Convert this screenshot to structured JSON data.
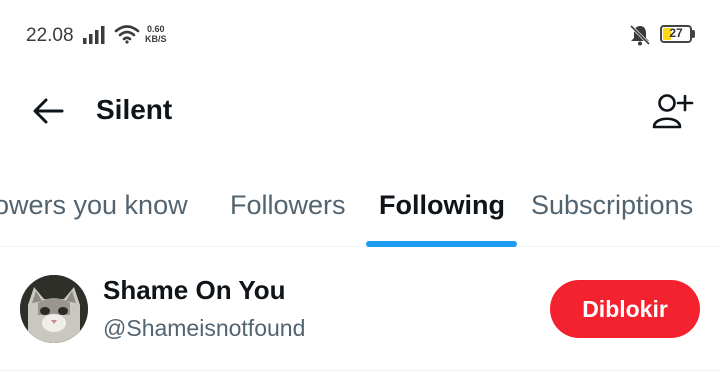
{
  "status_bar": {
    "time": "22.08",
    "speed_value": "0.60",
    "speed_unit": "KB/S",
    "battery": "27",
    "icons": [
      "signal-icon",
      "wifi-icon",
      "bell-muted-icon",
      "battery-icon"
    ],
    "battery_color": "#ffd814"
  },
  "header": {
    "title": "Silent",
    "icons": [
      "back-arrow-icon",
      "add-user-icon"
    ]
  },
  "tabs": {
    "items": [
      "owers you know",
      "Followers",
      "Following",
      "Subscriptions"
    ],
    "active": "Following",
    "indicator_color": "#1d9bf0"
  },
  "users": [
    {
      "name": "Shame On You",
      "handle": "@Shameisnotfound",
      "button_label": "Diblokir",
      "button_color": "#f4212e"
    }
  ]
}
